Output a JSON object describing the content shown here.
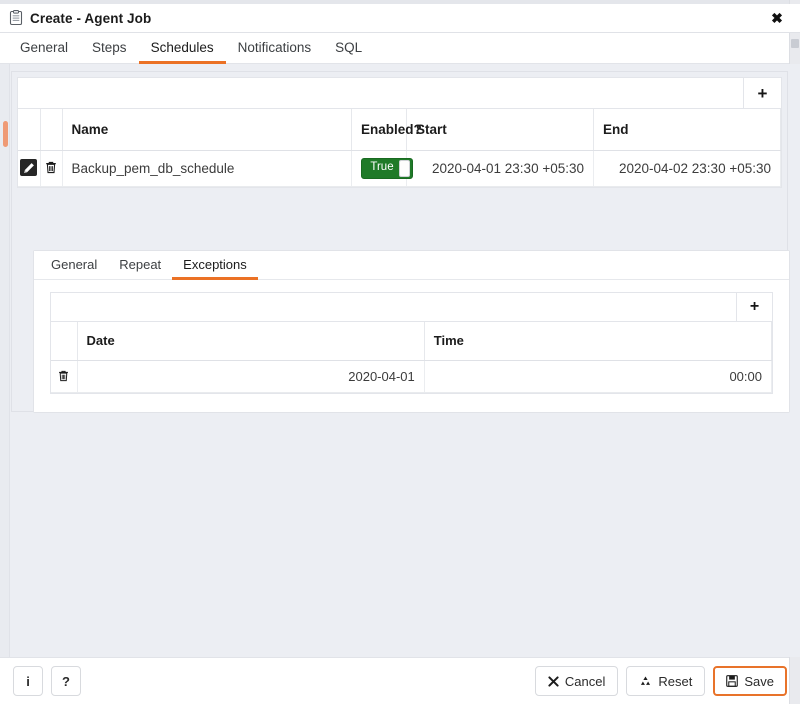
{
  "window": {
    "title": "Create - Agent Job",
    "title_icon": "clipboard-icon",
    "close_label": "✖"
  },
  "main_tabs": [
    {
      "label": "General",
      "active": false
    },
    {
      "label": "Steps",
      "active": false
    },
    {
      "label": "Schedules",
      "active": true
    },
    {
      "label": "Notifications",
      "active": false
    },
    {
      "label": "SQL",
      "active": false
    }
  ],
  "schedules_grid": {
    "add_label": "+",
    "columns": [
      "Name",
      "Enabled?",
      "Start",
      "End"
    ],
    "rows": [
      {
        "name": "Backup_pem_db_schedule",
        "enabled": "True",
        "start": "2020-04-01 23:30 +05:30",
        "end": "2020-04-02 23:30 +05:30"
      }
    ]
  },
  "detail_tabs": [
    {
      "label": "General",
      "active": false
    },
    {
      "label": "Repeat",
      "active": false
    },
    {
      "label": "Exceptions",
      "active": true
    }
  ],
  "exceptions_grid": {
    "add_label": "+",
    "columns": [
      "Date",
      "Time"
    ],
    "rows": [
      {
        "date": "2020-04-01",
        "time": "00:00"
      }
    ]
  },
  "footer": {
    "info_label": "i",
    "help_label": "?",
    "cancel_label": "Cancel",
    "reset_label": "Reset",
    "save_label": "Save"
  },
  "colors": {
    "accent": "#eb7125",
    "toggle_on": "#1f7a28",
    "window_bg": "#eceef3",
    "panel_bg": "#ffffff"
  }
}
